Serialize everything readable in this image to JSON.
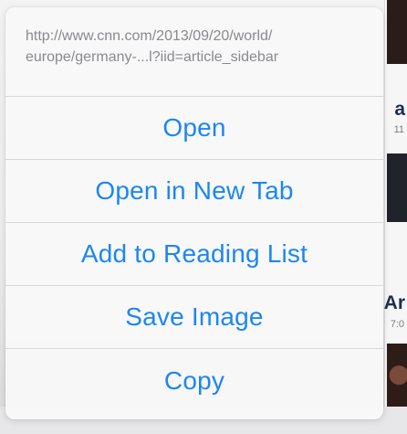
{
  "background": {
    "letters": [
      "a",
      "Ar"
    ],
    "sublabels": [
      "11",
      "7:0"
    ]
  },
  "sheet": {
    "url_lines": [
      "http://www.cnn.com/2013/09/20/world/",
      "europe/germany-...l?iid=article_sidebar"
    ],
    "actions": [
      "Open",
      "Open in New Tab",
      "Add to Reading List",
      "Save Image",
      "Copy"
    ]
  },
  "colors": {
    "accent": "#1d86f4",
    "url_text": "#8a8a8e"
  }
}
